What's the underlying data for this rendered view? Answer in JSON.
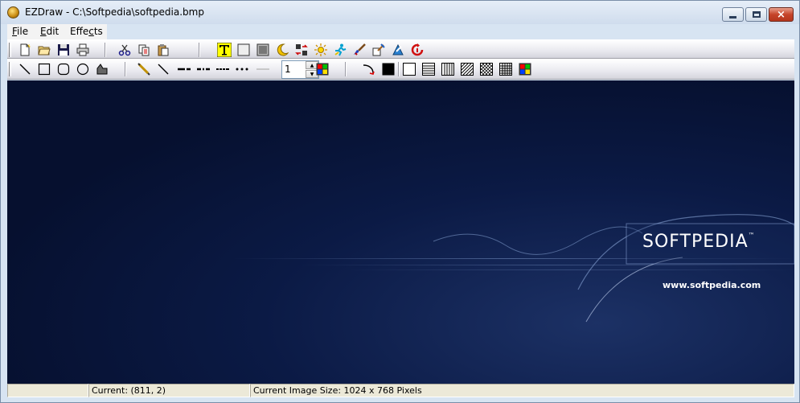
{
  "window": {
    "title": "EZDraw - C:\\Softpedia\\softpedia.bmp",
    "close_glyph": "×"
  },
  "menu": {
    "items": [
      {
        "underline": "F",
        "rest": "ile"
      },
      {
        "underline": "E",
        "rest": "dit"
      },
      {
        "underline": "",
        "rest": "Effe",
        "underline2": "c",
        "rest2": "ts"
      }
    ]
  },
  "toolbar": {
    "line_width_value": "1",
    "icons_row1": [
      "new-file-icon",
      "open-file-icon",
      "save-icon",
      "print-icon",
      "cut-icon",
      "copy-icon",
      "paste-icon",
      "text-tool-icon",
      "rectangle-select-icon",
      "fill-rectangle-icon",
      "crescent-icon",
      "flip-icon",
      "brightness-icon",
      "runner-icon",
      "brush-icon",
      "picker-icon",
      "transform-icon",
      "rotate-icon"
    ],
    "icons_row2": [
      "line-tool-icon",
      "rectangle-tool-icon",
      "rounded-rectangle-icon",
      "ellipse-tool-icon",
      "polygon-tool-icon",
      "pencil-icon",
      "diagonal-line-icon",
      "dash-style-1-icon",
      "dash-style-2-icon",
      "dash-style-3-icon",
      "dot-style-icon",
      "solid-line-icon",
      "color-palette-icon",
      "curve-tool-icon",
      "fill-color-icon",
      "pattern-empty-icon",
      "pattern-horizontal-icon",
      "pattern-vertical-icon",
      "pattern-diagonal-icon",
      "pattern-cross-diagonal-icon",
      "pattern-grid-icon",
      "pattern-palette-icon"
    ]
  },
  "canvas": {
    "logo": "SOFTPEDIA",
    "trademark": "™",
    "url": "www.softpedia.com",
    "background_color": "#0b1a45"
  },
  "status": {
    "panel1": "",
    "panel2": "Current: (811, 2)",
    "panel3": "Current Image Size: 1024 x 768 Pixels"
  }
}
